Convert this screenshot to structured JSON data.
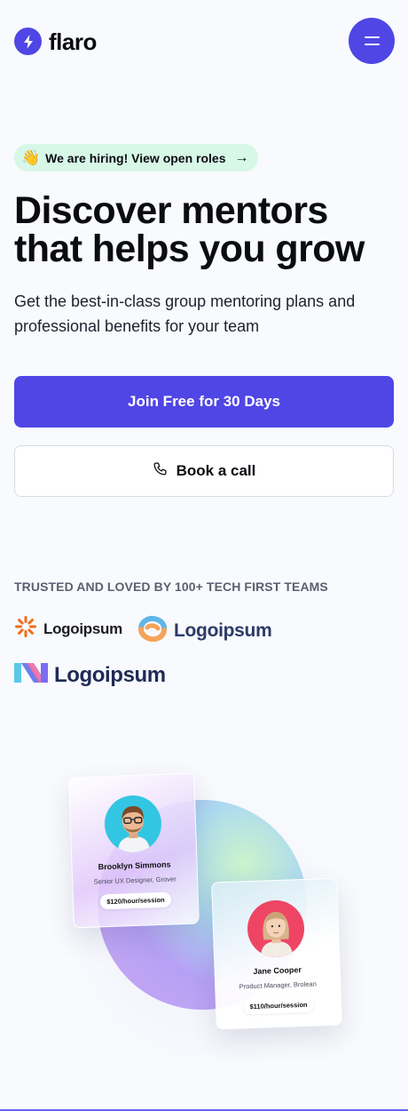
{
  "header": {
    "brand_name": "flaro",
    "menu_label": "menu"
  },
  "hiring_pill": {
    "emoji": "👋",
    "text": "We are hiring! View open roles",
    "arrow": "→"
  },
  "hero": {
    "title": "Discover mentors that helps you grow",
    "subtitle": "Get the best-in-class group mentoring plans and professional benefits for your team",
    "primary_button": "Join Free for 30 Days",
    "secondary_button": "Book a call"
  },
  "trusted": {
    "heading": "TRUSTED AND LOVED BY 100+ TECH FIRST TEAMS",
    "logos": [
      "Logoipsum",
      "Logoipsum",
      "Logoipsum"
    ]
  },
  "mentors": [
    {
      "name": "Brooklyn Simmons",
      "role": "Senior UX Designer, Grover",
      "price": "$120/hour/session"
    },
    {
      "name": "Jane Cooper",
      "role": "Product Manager, Brolean",
      "price": "$110/hour/session"
    }
  ],
  "colors": {
    "accent": "#4f46e5",
    "pill_bg": "#d7f7e7",
    "page_bg": "#f8fafd"
  },
  "icons": [
    "bolt-icon",
    "menu-icon",
    "arrow-right-icon",
    "phone-icon",
    "logo-sun-icon",
    "logo-ring-icon",
    "logo-n-icon"
  ]
}
